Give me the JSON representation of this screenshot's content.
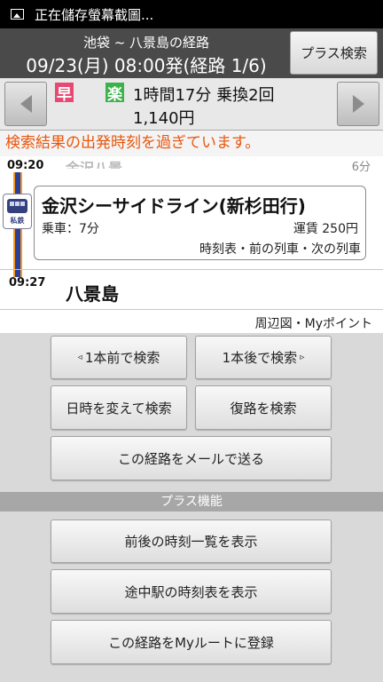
{
  "status_bar": {
    "notification_text": "正在儲存螢幕截圖..."
  },
  "header": {
    "route_name": "池袋 ~ 八景島の経路",
    "datetime": "09/23(月)  08:00発(経路 1/6)",
    "plus_search_label": "プラス検索"
  },
  "summary": {
    "badge_fast": "早",
    "badge_easy": "楽",
    "duration_transfers": "1時間17分 乗換2回",
    "fare": "1,140円",
    "badge_fast_color": "#e64a73",
    "badge_easy_color": "#3bb34a"
  },
  "warning": "検索結果の出発時刻を過ぎています。",
  "route": {
    "departure_time": "09:20",
    "departure_station_partial": "金沢八景",
    "departure_minutes": "6分",
    "train_icon_label": "私鉄",
    "segment_line": "金沢シーサイドライン(新杉田行)",
    "ride_time": "乗車：7分",
    "fare": "運賃 250円",
    "segment_links": "時刻表・前の列車・次の列車",
    "arrival_time": "09:27",
    "arrival_station": "八景島",
    "arrival_links": "周辺図・Myポイント"
  },
  "actions": {
    "prev_label": "1本前で検索",
    "next_label": "1本後で検索",
    "change_label": "日時を変えて検索",
    "return_label": "復路を検索",
    "mail_label": "この経路をメールで送る",
    "plus_section_title": "プラス機能",
    "timetable_list_label": "前後の時刻一覧を表示",
    "midway_label": "途中駅の時刻表を表示",
    "myroute_label": "この経路をMyルートに登録"
  }
}
